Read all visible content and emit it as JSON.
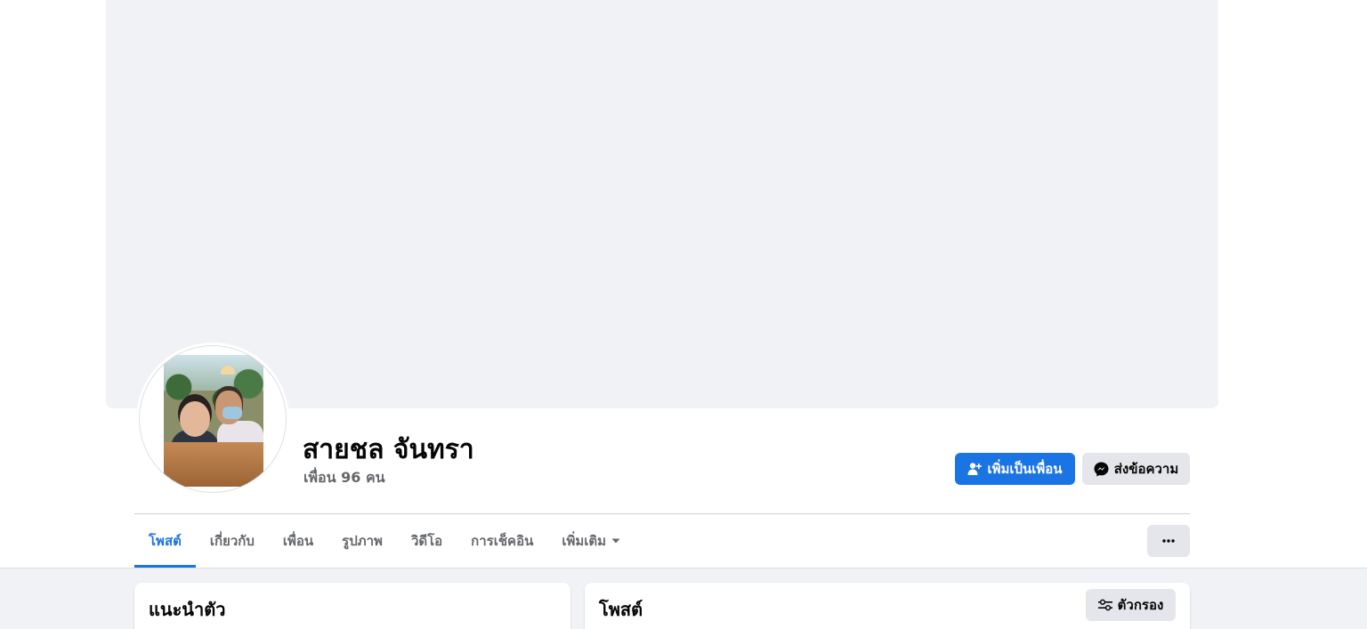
{
  "profile": {
    "name": "สายชล จันทรา",
    "friends_count": "เพื่อน 96 คน"
  },
  "actions": {
    "add_friend": "เพิ่มเป็นเพื่อน",
    "message": "ส่งข้อความ",
    "more": "···"
  },
  "tabs": [
    {
      "label": "โพสต์",
      "active": true
    },
    {
      "label": "เกี่ยวกับ",
      "active": false
    },
    {
      "label": "เพื่อน",
      "active": false
    },
    {
      "label": "รูปภาพ",
      "active": false
    },
    {
      "label": "วิดีโอ",
      "active": false
    },
    {
      "label": "การเช็คอิน",
      "active": false
    },
    {
      "label": "เพิ่มเติม",
      "active": false
    }
  ],
  "intro": {
    "title": "แนะนำตัว"
  },
  "posts": {
    "title": "โพสต์",
    "filter_label": "ตัวกรอง"
  },
  "colors": {
    "accent": "#1b74e4",
    "background": "#f0f2f5",
    "secondary_button": "#e4e6eb",
    "muted_text": "#65676b"
  },
  "icons": {
    "add_friend": "add-person-icon",
    "message": "messenger-icon",
    "more_tab": "caret-down-icon",
    "more_actions": "ellipsis-icon",
    "filter": "sliders-icon"
  }
}
